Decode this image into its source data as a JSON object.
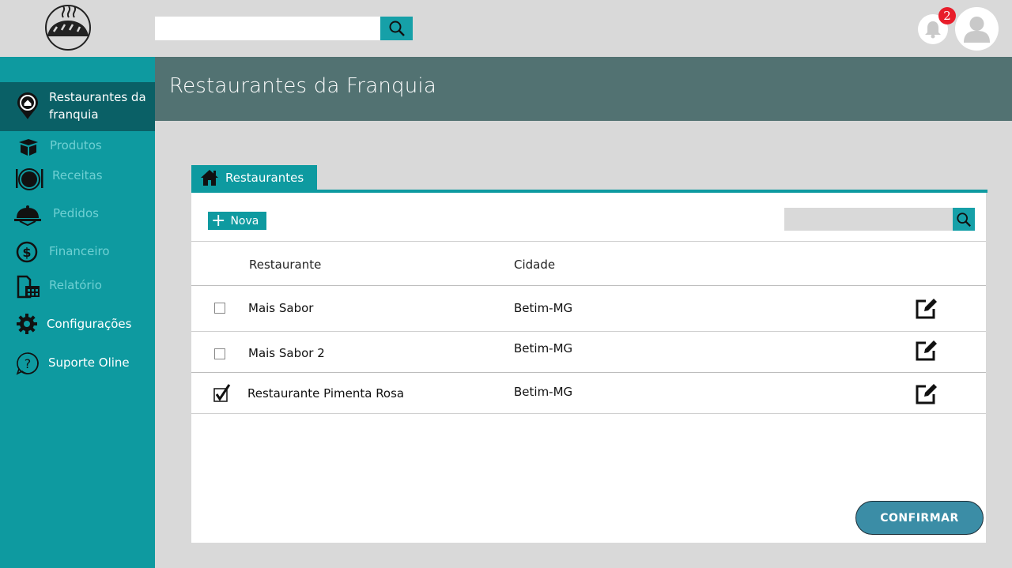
{
  "header": {
    "search": {
      "value": "",
      "placeholder": ""
    },
    "notifications_count": "2"
  },
  "sidebar": {
    "items": [
      {
        "label": "Restaurantes da franquia",
        "icon": "location-pin-icon"
      },
      {
        "label": "Produtos",
        "icon": "box-icon"
      },
      {
        "label": "Receitas",
        "icon": "plate-icon"
      },
      {
        "label": "Pedidos",
        "icon": "cloche-icon"
      },
      {
        "label": "Financeiro",
        "icon": "dollar-icon"
      },
      {
        "label": "Relatório",
        "icon": "report-icon"
      },
      {
        "label": "Configurações",
        "icon": "gear-icon"
      },
      {
        "label": "Suporte Oline",
        "icon": "question-icon"
      }
    ]
  },
  "page": {
    "title": "Restaurantes da Franquia"
  },
  "tab": {
    "label": "Restaurantes"
  },
  "toolbar": {
    "new_label": "Nova",
    "search": {
      "value": "",
      "placeholder": ""
    }
  },
  "table": {
    "columns": [
      "Restaurante",
      "Cidade"
    ],
    "rows": [
      {
        "name": "Mais Sabor",
        "city": "Betim-MG",
        "checked": false
      },
      {
        "name": "Mais Sabor 2",
        "city": "Betim-MG",
        "checked": false
      },
      {
        "name": "Restaurante Pimenta Rosa",
        "city": "Betim-MG",
        "checked": true
      }
    ]
  },
  "confirm_label": "CONFIRMAR",
  "colors": {
    "teal": "#0e9aa0",
    "teal_dark": "#0a6066",
    "header": "#527272",
    "confirm": "#3b8da6",
    "badge": "#e81d2a"
  }
}
